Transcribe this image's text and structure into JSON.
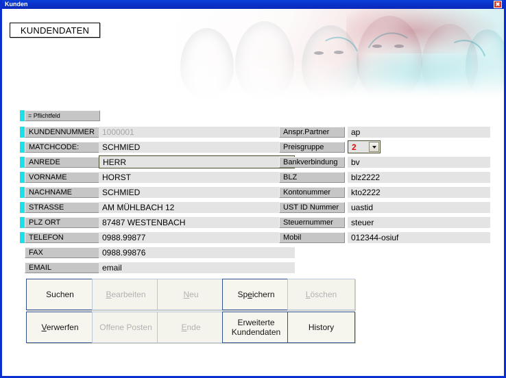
{
  "window": {
    "title": "Kunden",
    "close_label": "✖"
  },
  "page": {
    "title": "KUNDENDATEN",
    "legend": "= Pflichtfeld"
  },
  "colors": {
    "titlebar": "#0a30c8",
    "required_marker": "#1ce0e8",
    "label_bg": "#c6c6c6",
    "value_bg": "#e4e4e4",
    "button_border": "#2f4f8f",
    "button_bg": "#f7f6ee",
    "accent_red": "#d81010"
  },
  "left_fields": [
    {
      "label": "KUNDENNUMMER",
      "value": "1000001",
      "required": true,
      "type": "text",
      "disabled": true
    },
    {
      "label": "MATCHCODE:",
      "value": "SCHMIED",
      "required": true,
      "type": "text",
      "disabled": false
    },
    {
      "label": "ANREDE",
      "value": "HERR",
      "required": true,
      "type": "combo",
      "disabled": false
    },
    {
      "label": "VORNAME",
      "value": "HORST",
      "required": true,
      "type": "text",
      "disabled": false
    },
    {
      "label": "NACHNAME",
      "value": "SCHMIED",
      "required": true,
      "type": "text",
      "disabled": false
    },
    {
      "label": "STRASSE",
      "value": "AM MÜHLBACH 12",
      "required": true,
      "type": "text",
      "disabled": false
    },
    {
      "label": "PLZ ORT",
      "value": "87487  WESTENBACH",
      "required": true,
      "type": "text",
      "disabled": false
    },
    {
      "label": "TELEFON",
      "value": "0988.99877",
      "required": true,
      "type": "text",
      "disabled": false
    },
    {
      "label": "FAX",
      "value": "0988.99876",
      "required": false,
      "type": "text",
      "disabled": false
    },
    {
      "label": "EMAIL",
      "value": "email",
      "required": false,
      "type": "text",
      "disabled": false
    }
  ],
  "right_fields": [
    {
      "label": "Anspr.Partner",
      "value": "ap",
      "type": "text"
    },
    {
      "label": "Preisgruppe",
      "value": "2",
      "type": "combo",
      "value_color": "red"
    },
    {
      "label": "Bankverbindung",
      "value": "bv",
      "type": "text"
    },
    {
      "label": "BLZ",
      "value": "blz2222",
      "type": "text"
    },
    {
      "label": "Kontonummer",
      "value": "kto2222",
      "type": "text"
    },
    {
      "label": "UST ID Nummer",
      "value": "uastid",
      "type": "text"
    },
    {
      "label": "Steuernummer",
      "value": "steuer",
      "type": "text"
    },
    {
      "label": "Mobil",
      "value": "012344-osiuf",
      "type": "text"
    }
  ],
  "buttons": [
    {
      "label": "Suchen",
      "accel": "",
      "enabled": true,
      "row": 1,
      "col": 1
    },
    {
      "label": "Bearbeiten",
      "accel": "B",
      "enabled": false,
      "row": 1,
      "col": 2
    },
    {
      "label": "Neu",
      "accel": "N",
      "enabled": false,
      "row": 1,
      "col": 3
    },
    {
      "label": "Speichern",
      "accel": "e",
      "enabled": true,
      "row": 1,
      "col": 4
    },
    {
      "label": "Löschen",
      "accel": "L",
      "enabled": false,
      "row": 1,
      "col": 5
    },
    {
      "label": "Verwerfen",
      "accel": "V",
      "enabled": true,
      "row": 2,
      "col": 1
    },
    {
      "label": "Offene Posten",
      "accel": "",
      "enabled": false,
      "row": 2,
      "col": 2
    },
    {
      "label": "Ende",
      "accel": "E",
      "enabled": false,
      "row": 2,
      "col": 3
    },
    {
      "label": "Erweiterte Kundendaten",
      "accel": "",
      "enabled": true,
      "row": 2,
      "col": 4,
      "multiline": true
    },
    {
      "label": "History",
      "accel": "",
      "enabled": true,
      "row": 2,
      "col": 5
    }
  ]
}
